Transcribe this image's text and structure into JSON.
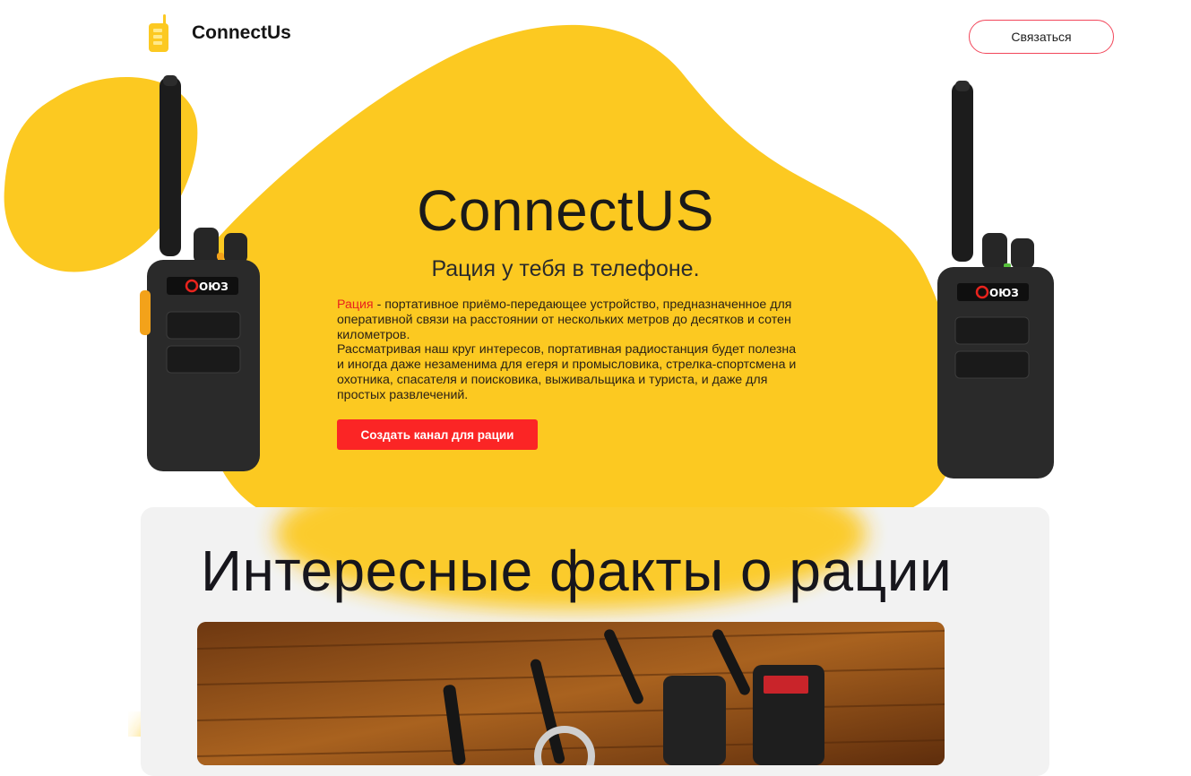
{
  "header": {
    "logo_text": "ConnectUs",
    "logo_icon": "walkie-talkie-icon",
    "contact_button": "Связаться"
  },
  "hero": {
    "title": "ConnectUS",
    "subtitle": "Рация у тебя в телефоне.",
    "desc_highlight": "Рация",
    "desc_p1": " - портативное приёмо-передающее устройство, предназначенное для оперативной связи на расстоянии от нескольких метров до десятков и сотен километров.",
    "desc_p2": "Рассматривая наш круг интересов, портативная радиостанция будет полезна и иногда даже незаменима для егеря и промысловика, стрелка-спортсмена и охотника, спасателя и поисковика, выживальщика и туриста, и даже для простых развлечений.",
    "create_button": "Создать канал для рации",
    "radio_brand": "ОЮЗ"
  },
  "facts": {
    "title": "Интересные факты о рации"
  },
  "colors": {
    "accent_yellow": "#fcc921",
    "button_red": "#fb2525",
    "outline_red": "#f2465a",
    "panel_gray": "#f2f2f2"
  }
}
